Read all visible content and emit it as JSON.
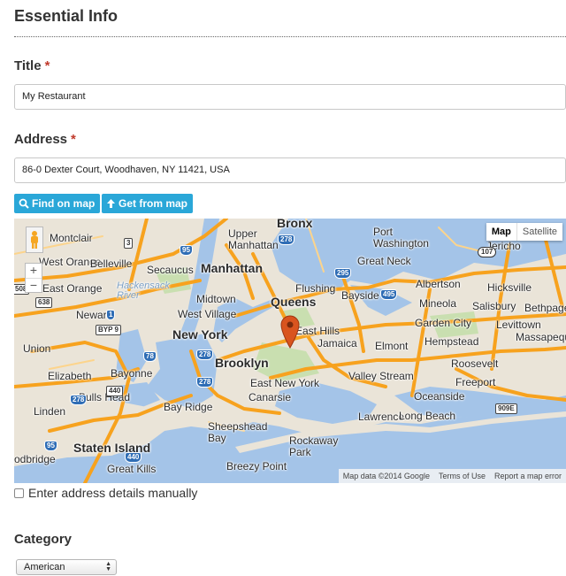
{
  "section": {
    "title": "Essential Info"
  },
  "title_field": {
    "label": "Title",
    "required_mark": "*",
    "value": "My Restaurant"
  },
  "address_field": {
    "label": "Address",
    "required_mark": "*",
    "value": "86-0 Dexter Court, Woodhaven, NY 11421, USA"
  },
  "buttons": {
    "find_on_map": "Find on map",
    "get_from_map": "Get from map"
  },
  "map": {
    "type_controls": {
      "map": "Map",
      "satellite": "Satellite",
      "selected": "Map"
    },
    "zoom": {
      "in": "+",
      "out": "−"
    },
    "attribution": {
      "data": "Map data ©2014 Google",
      "terms": "Terms of Use",
      "report": "Report a map error"
    },
    "places": {
      "bronx": "Bronx",
      "manhattan": "Manhattan",
      "queens": "Queens",
      "new_york": "New York",
      "brooklyn": "Brooklyn",
      "montclair": "Montclair",
      "west_orange": "West Orange",
      "belleville": "Belleville",
      "east_orange": "East Orange",
      "newark": "Newark",
      "union": "Union",
      "elizabeth": "Elizabeth",
      "bayonne": "Bayonne",
      "linden": "Linden",
      "bulls_head": "Bulls Head",
      "staten_island": "Staten Island",
      "great_kills": "Great Kills",
      "woodbridge": "odbridge",
      "secaucus": "Secaucus",
      "upper_manhattan": "Upper\nManhattan",
      "midtown": "Midtown",
      "west_village": "West Village",
      "flushing": "Flushing",
      "bayside": "Bayside",
      "great_neck": "Great Neck",
      "port_washington": "Port\nWashington",
      "albertson": "Albertson",
      "mineola": "Mineola",
      "garden_city": "Garden City",
      "hempstead": "Hempstead",
      "jamaica": "Jamaica",
      "elmont": "Elmont",
      "east_hills": "East Hills",
      "east_new_york": "East New York",
      "canarsie": "Canarsie",
      "bay_ridge": "Bay Ridge",
      "sheepshead_bay": "Sheepshead\nBay",
      "valley_stream": "Valley Stream",
      "roosevelt": "Roosevelt",
      "freeport": "Freeport",
      "oceanside": "Oceanside",
      "lawrence": "Lawrence",
      "long_beach": "Long Beach",
      "rockaway_park": "Rockaway\nPark",
      "breezy_point": "Breezy Point",
      "jericho": "Jericho",
      "hicksville": "Hicksville",
      "salisbury": "Salisbury",
      "bethpage": "Bethpage",
      "levittown": "Levittown",
      "massapequa": "Massapequ",
      "hackensack_river": "Hackensack\nRiver"
    },
    "shields": [
      "3",
      "95",
      "278",
      "295",
      "495",
      "107",
      "1",
      "638",
      "BYP 9",
      "78",
      "278",
      "440",
      "278",
      "95",
      "440",
      "278",
      "909E",
      "508"
    ],
    "colors": {
      "highway": "#f7a21e",
      "water": "#a4c4e8",
      "land": "#eae4d8",
      "park": "#c9dfb0",
      "marker": "#d9541e"
    }
  },
  "manual_address": {
    "label": "Enter address details manually",
    "checked": false
  },
  "category_field": {
    "label": "Category",
    "selected": "American"
  }
}
